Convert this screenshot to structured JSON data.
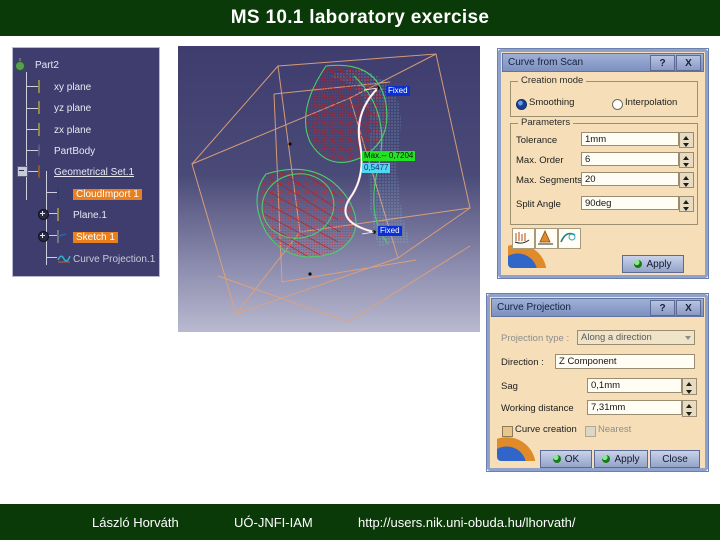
{
  "slide": {
    "title": "MS 10.1 laboratory exercise",
    "footer": {
      "author": "László Horváth",
      "org": "UÓ-JNFI-IAM",
      "url": "http://users.nik.uni-obuda.hu/lhorvath/"
    },
    "colors": {
      "bar_green": "#0a3a07",
      "tree_bg": "#3e3d6e",
      "selection_orange": "#e8801f",
      "dialog_bg": "#f6dfb8",
      "dialog_border_blue": "#8fa2cc"
    }
  },
  "spec_tree": {
    "name": "specification-tree",
    "items": [
      {
        "label": "Part2",
        "icon": "part-icon",
        "level": 0,
        "selected": false,
        "underline": false,
        "expander": "minus-square"
      },
      {
        "label": "xy plane",
        "icon": "plane-icon",
        "level": 1,
        "selected": false,
        "underline": false,
        "expander": "none"
      },
      {
        "label": "yz plane",
        "icon": "plane-icon",
        "level": 1,
        "selected": false,
        "underline": false,
        "expander": "none"
      },
      {
        "label": "zx plane",
        "icon": "plane-icon",
        "level": 1,
        "selected": false,
        "underline": false,
        "expander": "none"
      },
      {
        "label": "PartBody",
        "icon": "body-icon",
        "level": 1,
        "selected": false,
        "underline": false,
        "expander": "none"
      },
      {
        "label": "Geometrical Set.1",
        "icon": "geoset-icon",
        "level": 1,
        "selected": false,
        "underline": true,
        "expander": "minus-square"
      },
      {
        "label": "CloudImport 1",
        "icon": "cloud-icon",
        "level": 2,
        "selected": true,
        "underline": false,
        "expander": "none"
      },
      {
        "label": "Plane.1",
        "icon": "plane-icon",
        "level": 2,
        "selected": false,
        "underline": false,
        "expander": "plus-round"
      },
      {
        "label": "Sketch 1",
        "icon": "sketch-icon",
        "level": 2,
        "selected": true,
        "underline": false,
        "expander": "plus-round"
      },
      {
        "label": "Curve Projection.1",
        "icon": "curve-icon",
        "level": 2,
        "selected": false,
        "underline": false,
        "expander": "none"
      }
    ]
  },
  "viewport": {
    "name": "3d-viewport",
    "annotations": [
      {
        "text": "Fixed",
        "style": "blue"
      },
      {
        "text": "Max.-- 0,7204",
        "style": "green"
      },
      {
        "text": "0,5477",
        "style": "cyan"
      },
      {
        "text": "Fixed",
        "style": "blue"
      }
    ]
  },
  "dialog_curve_from_scan": {
    "title": "Curve from Scan",
    "help_button": "?",
    "close_button": "X",
    "creation_mode": {
      "group_label": "Creation mode",
      "options": [
        {
          "label": "Smoothing",
          "selected": true
        },
        {
          "label": "Interpolation",
          "selected": false
        }
      ]
    },
    "parameters": {
      "group_label": "Parameters",
      "fields": [
        {
          "label": "Tolerance",
          "value": "1mm"
        },
        {
          "label": "Max. Order",
          "value": "6"
        },
        {
          "label": "Max. Segments",
          "value": "20"
        },
        {
          "label": "Split Angle",
          "value": "90deg"
        }
      ]
    },
    "tool_icons": [
      "scan-smoothing-icon",
      "scan-segment-icon",
      "scan-curve-icon"
    ],
    "apply_label": "Apply"
  },
  "dialog_curve_projection": {
    "title": "Curve Projection",
    "help_button": "?",
    "close_button": "X",
    "projection_type": {
      "label": "Projection type :",
      "value": "Along a direction"
    },
    "direction": {
      "label": "Direction :",
      "value": "Z Component"
    },
    "sag": {
      "label": "Sag",
      "value": "0,1mm"
    },
    "working_distance": {
      "label": "Working distance",
      "value": "7,31mm"
    },
    "checkboxes": [
      {
        "label": "Curve creation",
        "checked": true,
        "enabled": true
      },
      {
        "label": "Nearest",
        "checked": false,
        "enabled": false
      }
    ],
    "buttons": [
      {
        "label": "OK",
        "globe": true
      },
      {
        "label": "Apply",
        "globe": true
      },
      {
        "label": "Close",
        "globe": false
      }
    ]
  }
}
